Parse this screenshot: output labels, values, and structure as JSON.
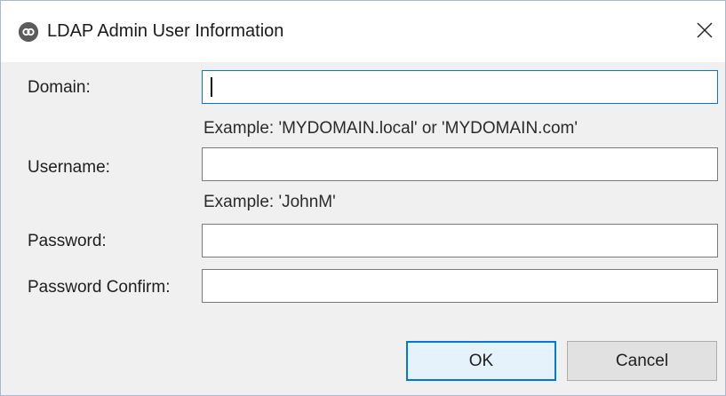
{
  "window": {
    "title": "LDAP Admin User Information",
    "close_glyph": "✕"
  },
  "icons": {
    "app": "app-logo-icon",
    "close": "close-icon"
  },
  "form": {
    "domain": {
      "label": "Domain:",
      "value": "",
      "placeholder": "",
      "hint": "Example:  'MYDOMAIN.local' or 'MYDOMAIN.com'"
    },
    "username": {
      "label": "Username:",
      "value": "",
      "placeholder": "",
      "hint": "Example:  'JohnM'"
    },
    "password": {
      "label": "Password:",
      "value": ""
    },
    "password_confirm": {
      "label": "Password Confirm:",
      "value": ""
    }
  },
  "buttons": {
    "ok": "OK",
    "cancel": "Cancel"
  },
  "colors": {
    "focus_border": "#0078d7",
    "dialog_background": "#f0f0f0"
  }
}
